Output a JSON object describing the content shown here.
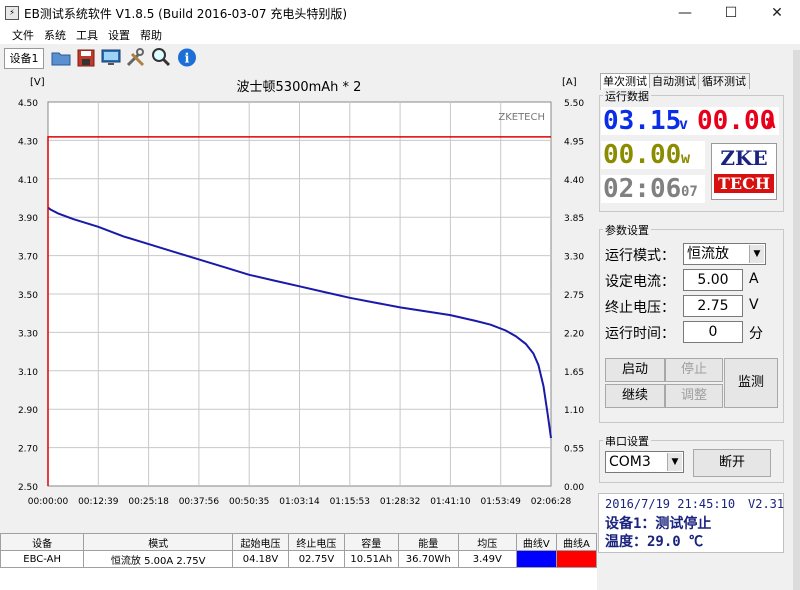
{
  "window": {
    "title": "EB测试系统软件 V1.8.5 (Build 2016-03-07 充电头特别版)",
    "minimize": "—",
    "maximize": "☐",
    "close": "✕"
  },
  "menu": [
    "文件",
    "系统",
    "工具",
    "设置",
    "帮助"
  ],
  "toolbar": {
    "device_tab": "设备1",
    "icons": [
      "open-folder-icon",
      "save-icon",
      "monitor-icon",
      "tools-icon",
      "search-icon",
      "info-icon"
    ]
  },
  "chart_data": {
    "type": "line",
    "title": "波士顿5300mAh * 2",
    "watermark": "ZKETECH",
    "ylabel_left": "[V]",
    "ylabel_right": "[A]",
    "ylim_left": [
      2.5,
      4.5
    ],
    "ylim_right": [
      0.0,
      5.5
    ],
    "yticks_left": [
      "4.50",
      "4.30",
      "4.10",
      "3.90",
      "3.70",
      "3.50",
      "3.30",
      "3.10",
      "2.90",
      "2.70",
      "2.50"
    ],
    "yticks_right": [
      "5.50",
      "4.95",
      "4.40",
      "3.85",
      "3.30",
      "2.75",
      "2.20",
      "1.65",
      "1.10",
      "0.55",
      "0.00"
    ],
    "xticks": [
      "00:00:00",
      "00:12:39",
      "00:25:18",
      "00:37:56",
      "00:50:35",
      "01:03:14",
      "01:15:53",
      "01:28:32",
      "01:41:10",
      "01:53:49",
      "02:06:28"
    ],
    "grid": true,
    "series": [
      {
        "name": "曲线V",
        "color": "#1a1aa8",
        "unit": "V",
        "x": [
          0.0,
          0.005,
          0.02,
          0.05,
          0.1,
          0.15,
          0.2,
          0.25,
          0.3,
          0.35,
          0.4,
          0.45,
          0.5,
          0.55,
          0.6,
          0.65,
          0.7,
          0.75,
          0.8,
          0.85,
          0.88,
          0.91,
          0.93,
          0.95,
          0.965,
          0.975,
          0.985,
          0.993,
          1.0
        ],
        "y": [
          3.95,
          3.94,
          3.92,
          3.89,
          3.85,
          3.8,
          3.76,
          3.72,
          3.68,
          3.64,
          3.6,
          3.57,
          3.54,
          3.51,
          3.48,
          3.455,
          3.43,
          3.41,
          3.39,
          3.36,
          3.34,
          3.31,
          3.28,
          3.24,
          3.19,
          3.13,
          3.02,
          2.88,
          2.75
        ]
      },
      {
        "name": "曲线A",
        "color": "#e00000",
        "unit": "A",
        "x": [
          0.0,
          0.0,
          0.002,
          1.0
        ],
        "y": [
          0.0,
          5.0,
          5.0,
          5.0
        ]
      }
    ]
  },
  "table": {
    "headers": [
      "设备",
      "模式",
      "起始电压",
      "终止电压",
      "容量",
      "能量",
      "均压",
      "曲线V",
      "曲线A"
    ],
    "row": [
      "EBC-AH",
      "恒流放  5.00A  2.75V",
      "04.18V",
      "02.75V",
      "10.51Ah",
      "36.70Wh",
      "3.49V",
      "",
      ""
    ],
    "curve_colors": {
      "v": "#0000ff",
      "a": "#ff0000"
    }
  },
  "right": {
    "tabs": [
      "单次测试",
      "自动测试",
      "循环测试"
    ],
    "running": {
      "title": "运行数据",
      "voltage": "03.15",
      "voltage_unit": "v",
      "current": "00.00",
      "current_unit": "A",
      "power": "00.00",
      "power_unit": "w",
      "time": "02:06",
      "time_sec": "07",
      "logo_top": "ZKE",
      "logo_bottom": "TECH",
      "colors": {
        "voltage": "#0a2de8",
        "current": "#e8001a",
        "power": "#8c8c00",
        "time": "#808080"
      }
    },
    "params": {
      "title": "参数设置",
      "mode_label": "运行模式：",
      "mode_value": "恒流放",
      "current_label": "设定电流：",
      "current_value": "5.00",
      "current_unit": "A",
      "cutoff_label": "终止电压：",
      "cutoff_value": "2.75",
      "cutoff_unit": "V",
      "time_label": "运行时间：",
      "time_value": "0",
      "time_unit": "分",
      "btn_start": "启动",
      "btn_stop": "停止",
      "btn_continue": "继续",
      "btn_adjust": "调整",
      "btn_monitor": "监测"
    },
    "serial": {
      "title": "串口设置",
      "port": "COM3",
      "disconnect": "断开"
    },
    "status": {
      "datetime": "2016/7/19 21:45:10",
      "version": "V2.31",
      "device_status": "设备1：测试停止",
      "temperature": "温度：29.0 ℃"
    }
  }
}
